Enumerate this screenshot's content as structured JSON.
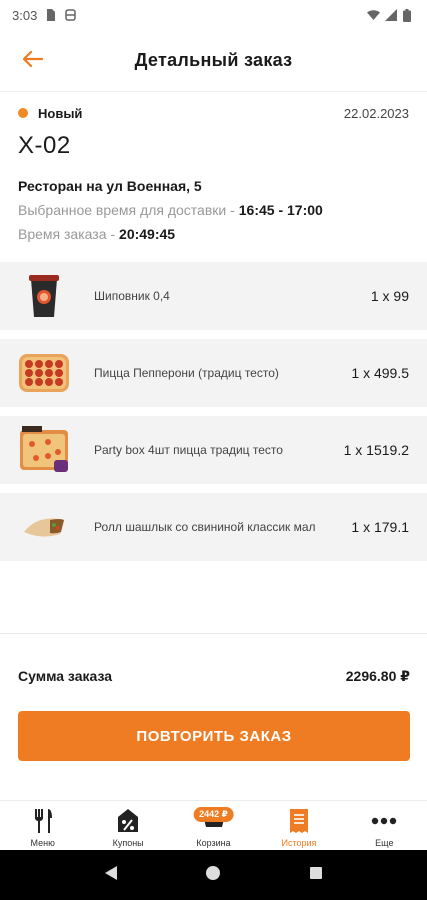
{
  "status_bar": {
    "time": "3:03"
  },
  "header": {
    "title": "Детальный заказ",
    "back_icon": "arrow-left-icon"
  },
  "order": {
    "status": "Новый",
    "status_color": "#f08a24",
    "date": "22.02.2023",
    "number": "X-02",
    "restaurant": "Ресторан на ул Военная, 5",
    "delivery_time_label": "Выбранное время для доставки -",
    "delivery_time_value": "16:45 - 17:00",
    "order_time_label": "Время заказа -",
    "order_time_value": "20:49:45"
  },
  "items": [
    {
      "name": "Шиповник 0,4",
      "qty": "1 x 99"
    },
    {
      "name": "Пицца Пепперони (традиц тесто)",
      "qty": "1 x 499.5"
    },
    {
      "name": "Party box 4шт пицца традиц тесто",
      "qty": "1 x 1519.2"
    },
    {
      "name": "Ролл шашлык со свининой классик мал",
      "qty": "1 x 179.1"
    }
  ],
  "summary": {
    "label": "Сумма заказа",
    "value": "2296.80 ₽"
  },
  "repeat_button": "ПОВТОРИТЬ ЗАКАЗ",
  "accent_color": "#ef7c22",
  "tabs": [
    {
      "label": "Меню",
      "icon": "fork-knife-icon"
    },
    {
      "label": "Купоны",
      "icon": "coupon-tag-icon"
    },
    {
      "label": "Корзина",
      "icon": "cart-icon",
      "badge": "2442 ₽"
    },
    {
      "label": "История",
      "icon": "receipt-icon",
      "active": true
    },
    {
      "label": "Еще",
      "icon": "more-dots-icon"
    }
  ]
}
